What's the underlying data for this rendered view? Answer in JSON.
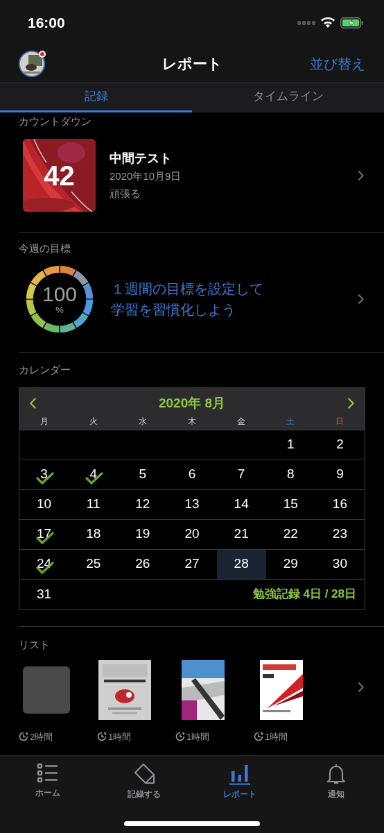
{
  "status_bar": {
    "time": "16:00"
  },
  "nav": {
    "title": "レポート",
    "action": "並び替え",
    "avatar_badge": true
  },
  "tabs": [
    {
      "label": "記録",
      "selected": true
    },
    {
      "label": "タイムライン",
      "selected": false
    }
  ],
  "countdown": {
    "heading": "カウントダウン",
    "days": "42",
    "title": "中間テスト",
    "date": "2020年10月9日",
    "note": "頑張る"
  },
  "weekly_goal": {
    "heading": "今週の目標",
    "percent": "100",
    "unit": "%",
    "message_lines": [
      "１週間の目標を設定して",
      "学習を習慣化しよう"
    ]
  },
  "calendar": {
    "heading": "カレンダー",
    "month": "2020年 8月",
    "weekdays": [
      {
        "label": "月",
        "kind": "weekday"
      },
      {
        "label": "火",
        "kind": "weekday"
      },
      {
        "label": "水",
        "kind": "weekday"
      },
      {
        "label": "木",
        "kind": "weekday"
      },
      {
        "label": "金",
        "kind": "weekday"
      },
      {
        "label": "土",
        "kind": "saturday"
      },
      {
        "label": "日",
        "kind": "sunday"
      }
    ],
    "weeks": [
      [
        {
          "kind": "blank"
        },
        {
          "kind": "blank"
        },
        {
          "kind": "blank"
        },
        {
          "kind": "blank"
        },
        {
          "kind": "blank"
        },
        {
          "kind": "day",
          "day": "1",
          "checked": false,
          "selected": false
        },
        {
          "kind": "day",
          "day": "2",
          "checked": false,
          "selected": false
        }
      ],
      [
        {
          "kind": "day",
          "day": "3",
          "checked": true,
          "selected": false
        },
        {
          "kind": "day",
          "day": "4",
          "checked": true,
          "selected": false
        },
        {
          "kind": "day",
          "day": "5",
          "checked": false,
          "selected": false
        },
        {
          "kind": "day",
          "day": "6",
          "checked": false,
          "selected": false
        },
        {
          "kind": "day",
          "day": "7",
          "checked": false,
          "selected": false
        },
        {
          "kind": "day",
          "day": "8",
          "checked": false,
          "selected": false
        },
        {
          "kind": "day",
          "day": "9",
          "checked": false,
          "selected": false
        }
      ],
      [
        {
          "kind": "day",
          "day": "10",
          "checked": false,
          "selected": false
        },
        {
          "kind": "day",
          "day": "11",
          "checked": false,
          "selected": false
        },
        {
          "kind": "day",
          "day": "12",
          "checked": false,
          "selected": false
        },
        {
          "kind": "day",
          "day": "13",
          "checked": false,
          "selected": false
        },
        {
          "kind": "day",
          "day": "14",
          "checked": false,
          "selected": false
        },
        {
          "kind": "day",
          "day": "15",
          "checked": false,
          "selected": false
        },
        {
          "kind": "day",
          "day": "16",
          "checked": false,
          "selected": false
        }
      ],
      [
        {
          "kind": "day",
          "day": "17",
          "checked": true,
          "selected": false
        },
        {
          "kind": "day",
          "day": "18",
          "checked": false,
          "selected": false
        },
        {
          "kind": "day",
          "day": "19",
          "checked": false,
          "selected": false
        },
        {
          "kind": "day",
          "day": "20",
          "checked": false,
          "selected": false
        },
        {
          "kind": "day",
          "day": "21",
          "checked": false,
          "selected": false
        },
        {
          "kind": "day",
          "day": "22",
          "checked": false,
          "selected": false
        },
        {
          "kind": "day",
          "day": "23",
          "checked": false,
          "selected": false
        }
      ],
      [
        {
          "kind": "day",
          "day": "24",
          "checked": true,
          "selected": false
        },
        {
          "kind": "day",
          "day": "25",
          "checked": false,
          "selected": false
        },
        {
          "kind": "day",
          "day": "26",
          "checked": false,
          "selected": false
        },
        {
          "kind": "day",
          "day": "27",
          "checked": false,
          "selected": false
        },
        {
          "kind": "day",
          "day": "28",
          "checked": false,
          "selected": true
        },
        {
          "kind": "day",
          "day": "29",
          "checked": false,
          "selected": false
        },
        {
          "kind": "day",
          "day": "30",
          "checked": false,
          "selected": false
        }
      ],
      [
        {
          "kind": "day",
          "day": "31",
          "checked": false,
          "selected": false
        }
      ]
    ],
    "summary": "勉強記録 4日 / 28日"
  },
  "list": {
    "heading": "リスト",
    "items": [
      {
        "kind": "placeholder",
        "duration": "2時間"
      },
      {
        "kind": "picture",
        "duration": "1時間"
      },
      {
        "kind": "picture",
        "duration": "1時間"
      },
      {
        "kind": "picture",
        "duration": "1時間"
      }
    ]
  },
  "tab_bar": [
    {
      "kind": "home",
      "label": "ホーム",
      "selected": false
    },
    {
      "kind": "record",
      "label": "記録する",
      "selected": false
    },
    {
      "kind": "report",
      "label": "レポート",
      "selected": true
    },
    {
      "kind": "bell",
      "label": "通知",
      "selected": false
    }
  ]
}
